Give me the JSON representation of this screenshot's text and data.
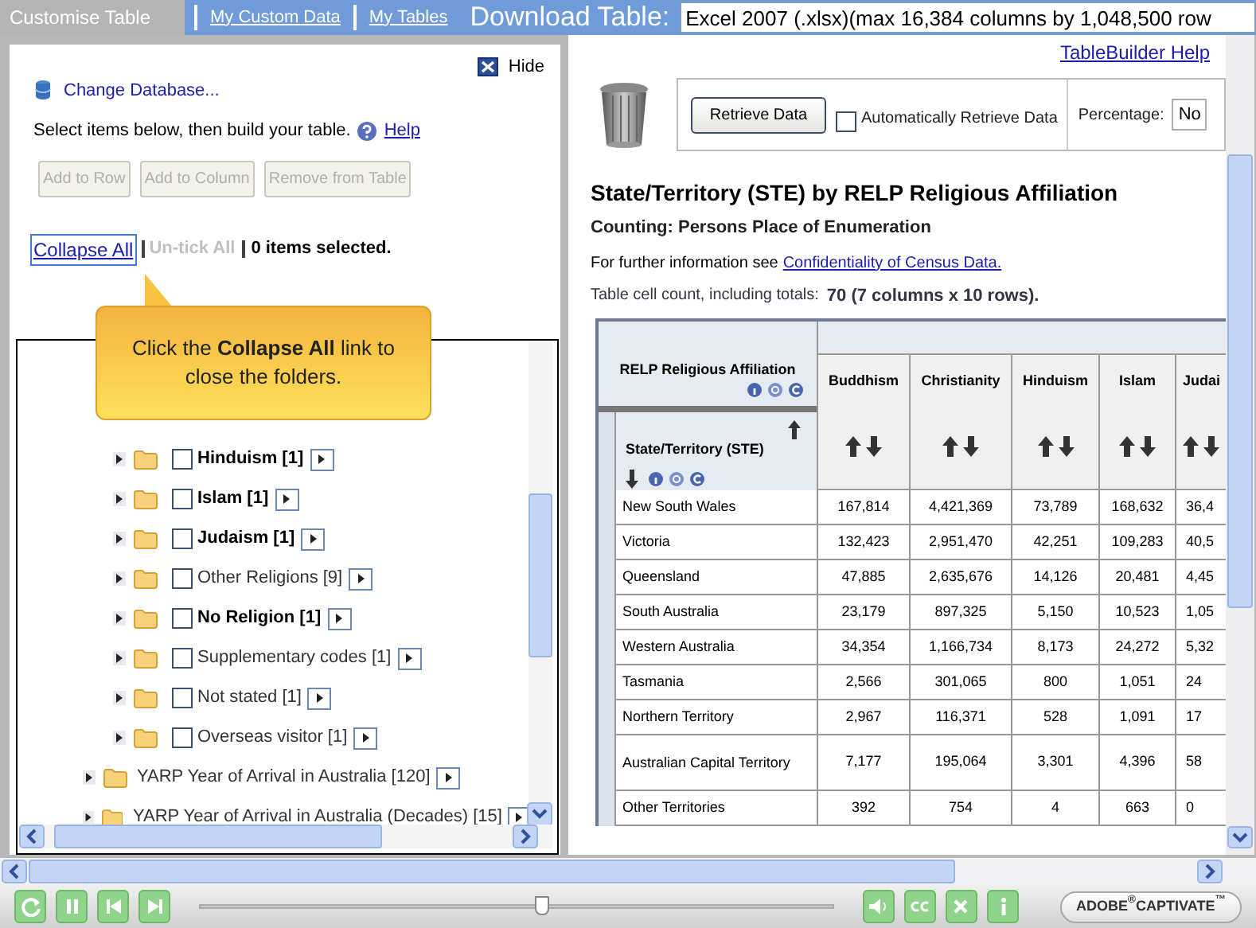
{
  "top_bar": {
    "tabs": [
      {
        "label": "Customise Table",
        "selected": true
      },
      {
        "label": "My Custom Data",
        "selected": false
      },
      {
        "label": "My Tables",
        "selected": false
      }
    ],
    "download_label": "Download Table:",
    "download_format": "Excel 2007 (.xlsx)(max 16,384 columns by 1,048,500 row"
  },
  "left_panel": {
    "hide_label": "Hide",
    "change_database": "Change Database...",
    "instructions": "Select items below, then build your table.",
    "help_link": "Help",
    "buttons": [
      {
        "label": "Add to Row",
        "disabled": true
      },
      {
        "label": "Add to Column",
        "disabled": true
      },
      {
        "label": "Remove from Table",
        "disabled": true
      }
    ],
    "collapse_all": "Collapse All",
    "untick_all": {
      "label": "Un-tick All",
      "disabled": true
    },
    "selection_count": "0 items selected.",
    "tree": [
      {
        "children": [
          {
            "label": "Hinduism [1]",
            "bold": true,
            "checked": false
          },
          {
            "label": "Islam [1]",
            "bold": true,
            "checked": false
          },
          {
            "label": "Judaism [1]",
            "bold": true,
            "checked": false
          },
          {
            "label": "Other Religions [9]",
            "bold": false,
            "checked": false
          },
          {
            "label": "No Religion [1]",
            "bold": true,
            "checked": false
          },
          {
            "label": "Supplementary codes [1]",
            "bold": false,
            "checked": false
          },
          {
            "label": "Not stated [1]",
            "bold": false,
            "checked": false
          },
          {
            "label": "Overseas visitor [1]",
            "bold": false,
            "checked": false
          }
        ]
      },
      {
        "label": "YARP Year of Arrival in Australia [120]",
        "bold": false
      },
      {
        "label": "YARP Year of Arrival in Australia (Decades) [15]",
        "bold": false
      }
    ]
  },
  "callout": {
    "text": "Click the **Collapse All** link to close the folders."
  },
  "right_panel": {
    "help_link": "TableBuilder Help",
    "retrieve_button": "Retrieve Data",
    "auto_retrieve": {
      "label": "Automatically Retrieve Data",
      "checked": false
    },
    "percentage_label": "Percentage:",
    "percentage_value": "No",
    "title": "State/Territory (STE) by RELP Religious Affiliation",
    "counting": "Counting: Persons Place of Enumeration",
    "info_text": "For further information see",
    "info_link": "Confidentiality of Census Data.",
    "cell_count_label": "Table cell count, including totals:",
    "cell_count": "70 (7 columns x 10 rows)."
  },
  "table": {
    "column_variable": "RELP Religious Affiliation",
    "row_variable": "State/Territory (STE)",
    "columns": [
      "Buddhism",
      "Christianity",
      "Hinduism",
      "Islam",
      "Judai"
    ],
    "rows": [
      {
        "label": "New South Wales",
        "values": [
          "167,814",
          "4,421,369",
          "73,789",
          "168,632",
          "36,4"
        ]
      },
      {
        "label": "Victoria",
        "values": [
          "132,423",
          "2,951,470",
          "42,251",
          "109,283",
          "40,5"
        ]
      },
      {
        "label": "Queensland",
        "values": [
          "47,885",
          "2,635,676",
          "14,126",
          "20,481",
          "4,45"
        ]
      },
      {
        "label": "South Australia",
        "values": [
          "23,179",
          "897,325",
          "5,150",
          "10,523",
          "1,05"
        ]
      },
      {
        "label": "Western Australia",
        "values": [
          "34,354",
          "1,166,734",
          "8,173",
          "24,272",
          "5,32"
        ]
      },
      {
        "label": "Tasmania",
        "values": [
          "2,566",
          "301,065",
          "800",
          "1,051",
          "24"
        ]
      },
      {
        "label": "Northern Territory",
        "values": [
          "2,967",
          "116,371",
          "528",
          "1,091",
          "17"
        ]
      },
      {
        "label": "Australian Capital Territory",
        "values": [
          "7,177",
          "195,064",
          "3,301",
          "4,396",
          "58"
        ]
      },
      {
        "label": "Other Territories",
        "values": [
          "392",
          "754",
          "4",
          "663",
          "0"
        ]
      }
    ]
  },
  "player": {
    "level": 0.54,
    "brand": "ADOBE$^{®}$CAPTIVATE$^{™}$"
  }
}
